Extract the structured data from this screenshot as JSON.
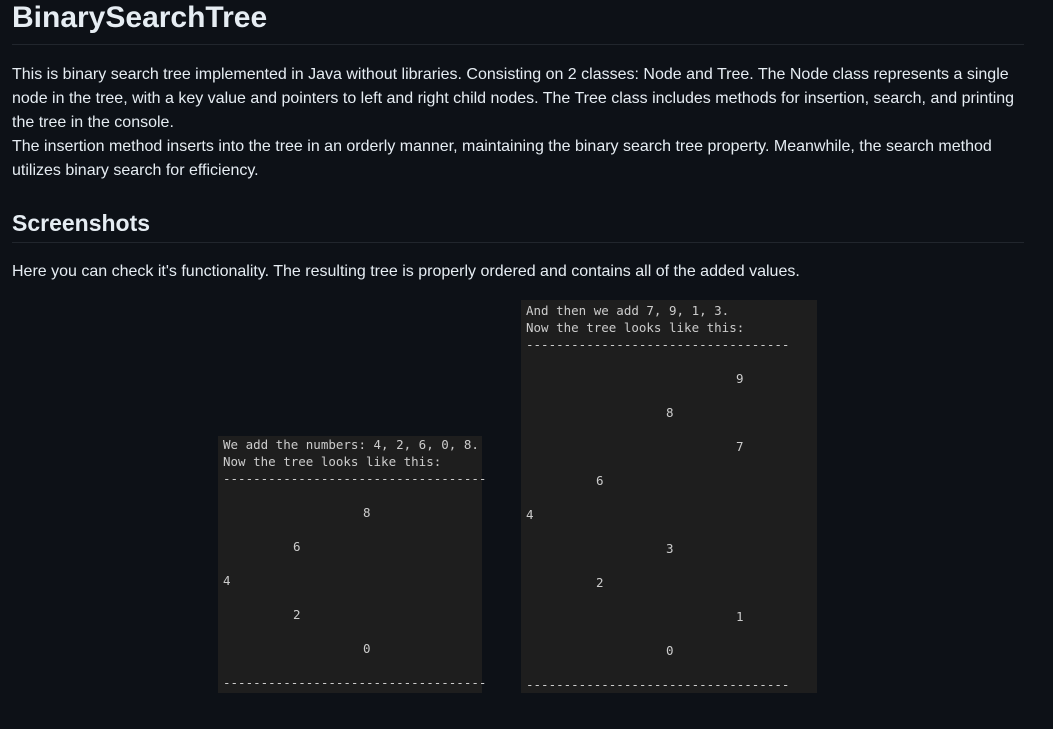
{
  "title": "BinarySearchTree",
  "description": {
    "p1": "This is binary search tree implemented in Java without libraries. Consisting on 2 classes: Node and Tree. The Node class represents a single node in the tree, with a key value and pointers to left and right child nodes. The Tree class includes methods for insertion, search, and printing the tree in the console.",
    "p2": "The insertion method inserts into the tree in an orderly manner, maintaining the binary search tree property. Meanwhile, the search method utilizes binary search for efficiency."
  },
  "screenshots_heading": "Screenshots",
  "screenshots_intro": "Here you can check it's functionality. The resulting tree is properly ordered and contains all of the added values.",
  "console1": {
    "line1": "We add the numbers: 4, 2, 6, 0, 8.",
    "line2": "Now the tree looks like this:",
    "divider_top": "-----------------------------------",
    "divider_bottom": "-----------------------------------",
    "nodes": [
      "8",
      "6",
      "4",
      "2",
      "0"
    ]
  },
  "console2": {
    "line1": "And then we add 7, 9, 1, 3.",
    "line2": "Now the tree looks like this:",
    "divider_top": "-----------------------------------",
    "divider_bottom": "-----------------------------------",
    "nodes": [
      "9",
      "8",
      "7",
      "6",
      "4",
      "3",
      "2",
      "1",
      "0"
    ]
  }
}
